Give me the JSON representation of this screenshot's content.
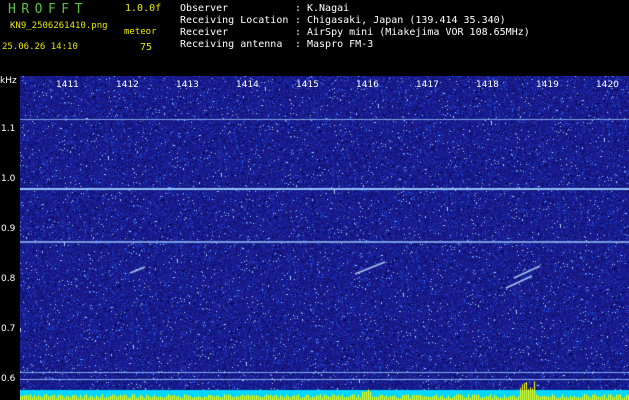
{
  "header": {
    "app_title": "HROFFT",
    "app_version": "1.0.0f",
    "file_name": "KN9_2506261410.png",
    "meteor_label": "meteor",
    "timestamp": "25.06.26 14:10",
    "meteor_count": "75",
    "info": [
      {
        "label": "Observer",
        "value": "K.Nagai"
      },
      {
        "label": "Receiving Location",
        "value": "Chigasaki, Japan (139.414 35.340)"
      },
      {
        "label": "Receiver",
        "value": "AirSpy mini (Miakejima VOR 108.65MHz)"
      },
      {
        "label": "Receiving antenna",
        "value": "Maspro FM-3"
      }
    ]
  },
  "axis": {
    "freq_unit": "kHz",
    "freq_ticks": [
      "1.1",
      "1.0",
      "0.9",
      "0.8",
      "0.7",
      "0.6"
    ],
    "minute_ticks": [
      "1411",
      "1412",
      "1413",
      "1414",
      "1415",
      "1416",
      "1417",
      "1418",
      "1419",
      "1420"
    ]
  },
  "colors": {
    "background_noise": "#1a1a8c",
    "carrier_line": "#9fd0ff",
    "meteor_trace": "#bfe4ff",
    "bottom_band": "#00d8ff",
    "spike": "#ffff00"
  }
}
